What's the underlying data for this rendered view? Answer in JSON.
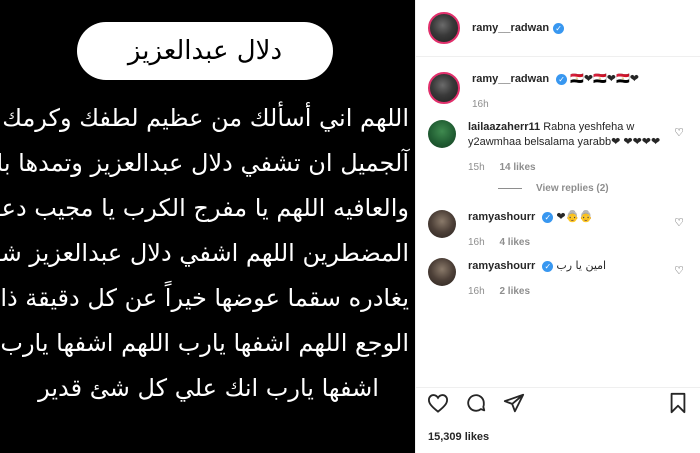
{
  "post": {
    "title_pill": "دلال عبدالعزيز",
    "prayer_lines": [
      "اللهم اني أسألك من عظيم لطفك وكرمك وسترك",
      "آلجميل ان تشفي دلال عبدالعزيز وتمدها بالصحه",
      "والعافيه اللهم يا مفرج الكرب يا مجيب دعوه",
      "المضطرين اللهم اشفي دلال عبدالعزيز شفاءً لا",
      "يغادره سقما عوضها خيراً عن كل دقيقة ذاقت فيها",
      "الوجع اللهم اشفها يارب اللهم اشفها يارب اللهم",
      "اشفها يارب انك علي كل شئ قدير"
    ]
  },
  "header": {
    "username": "ramy__radwan"
  },
  "caption": {
    "username": "ramy__radwan",
    "text": "🇪🇬❤🇪🇬❤🇪🇬❤",
    "time": "16h"
  },
  "comments": [
    {
      "username": "lailaazaherr11",
      "text": "Rabna yeshfeha w y2awmhaa belsalama yarabb❤ ❤❤❤❤",
      "time": "15h",
      "likes": "14 likes"
    },
    {
      "username": "ramyashourr",
      "text": "❤👵👵",
      "time": "16h",
      "likes": "4 likes"
    },
    {
      "username": "ramyashourr",
      "text": "امين يا رب",
      "time": "16h",
      "likes": "2 likes"
    }
  ],
  "view_replies": "View replies (2)",
  "likes_total": "15,309 likes",
  "colors": {
    "verified": "#3897f0",
    "story_ring": "#e1306c"
  }
}
